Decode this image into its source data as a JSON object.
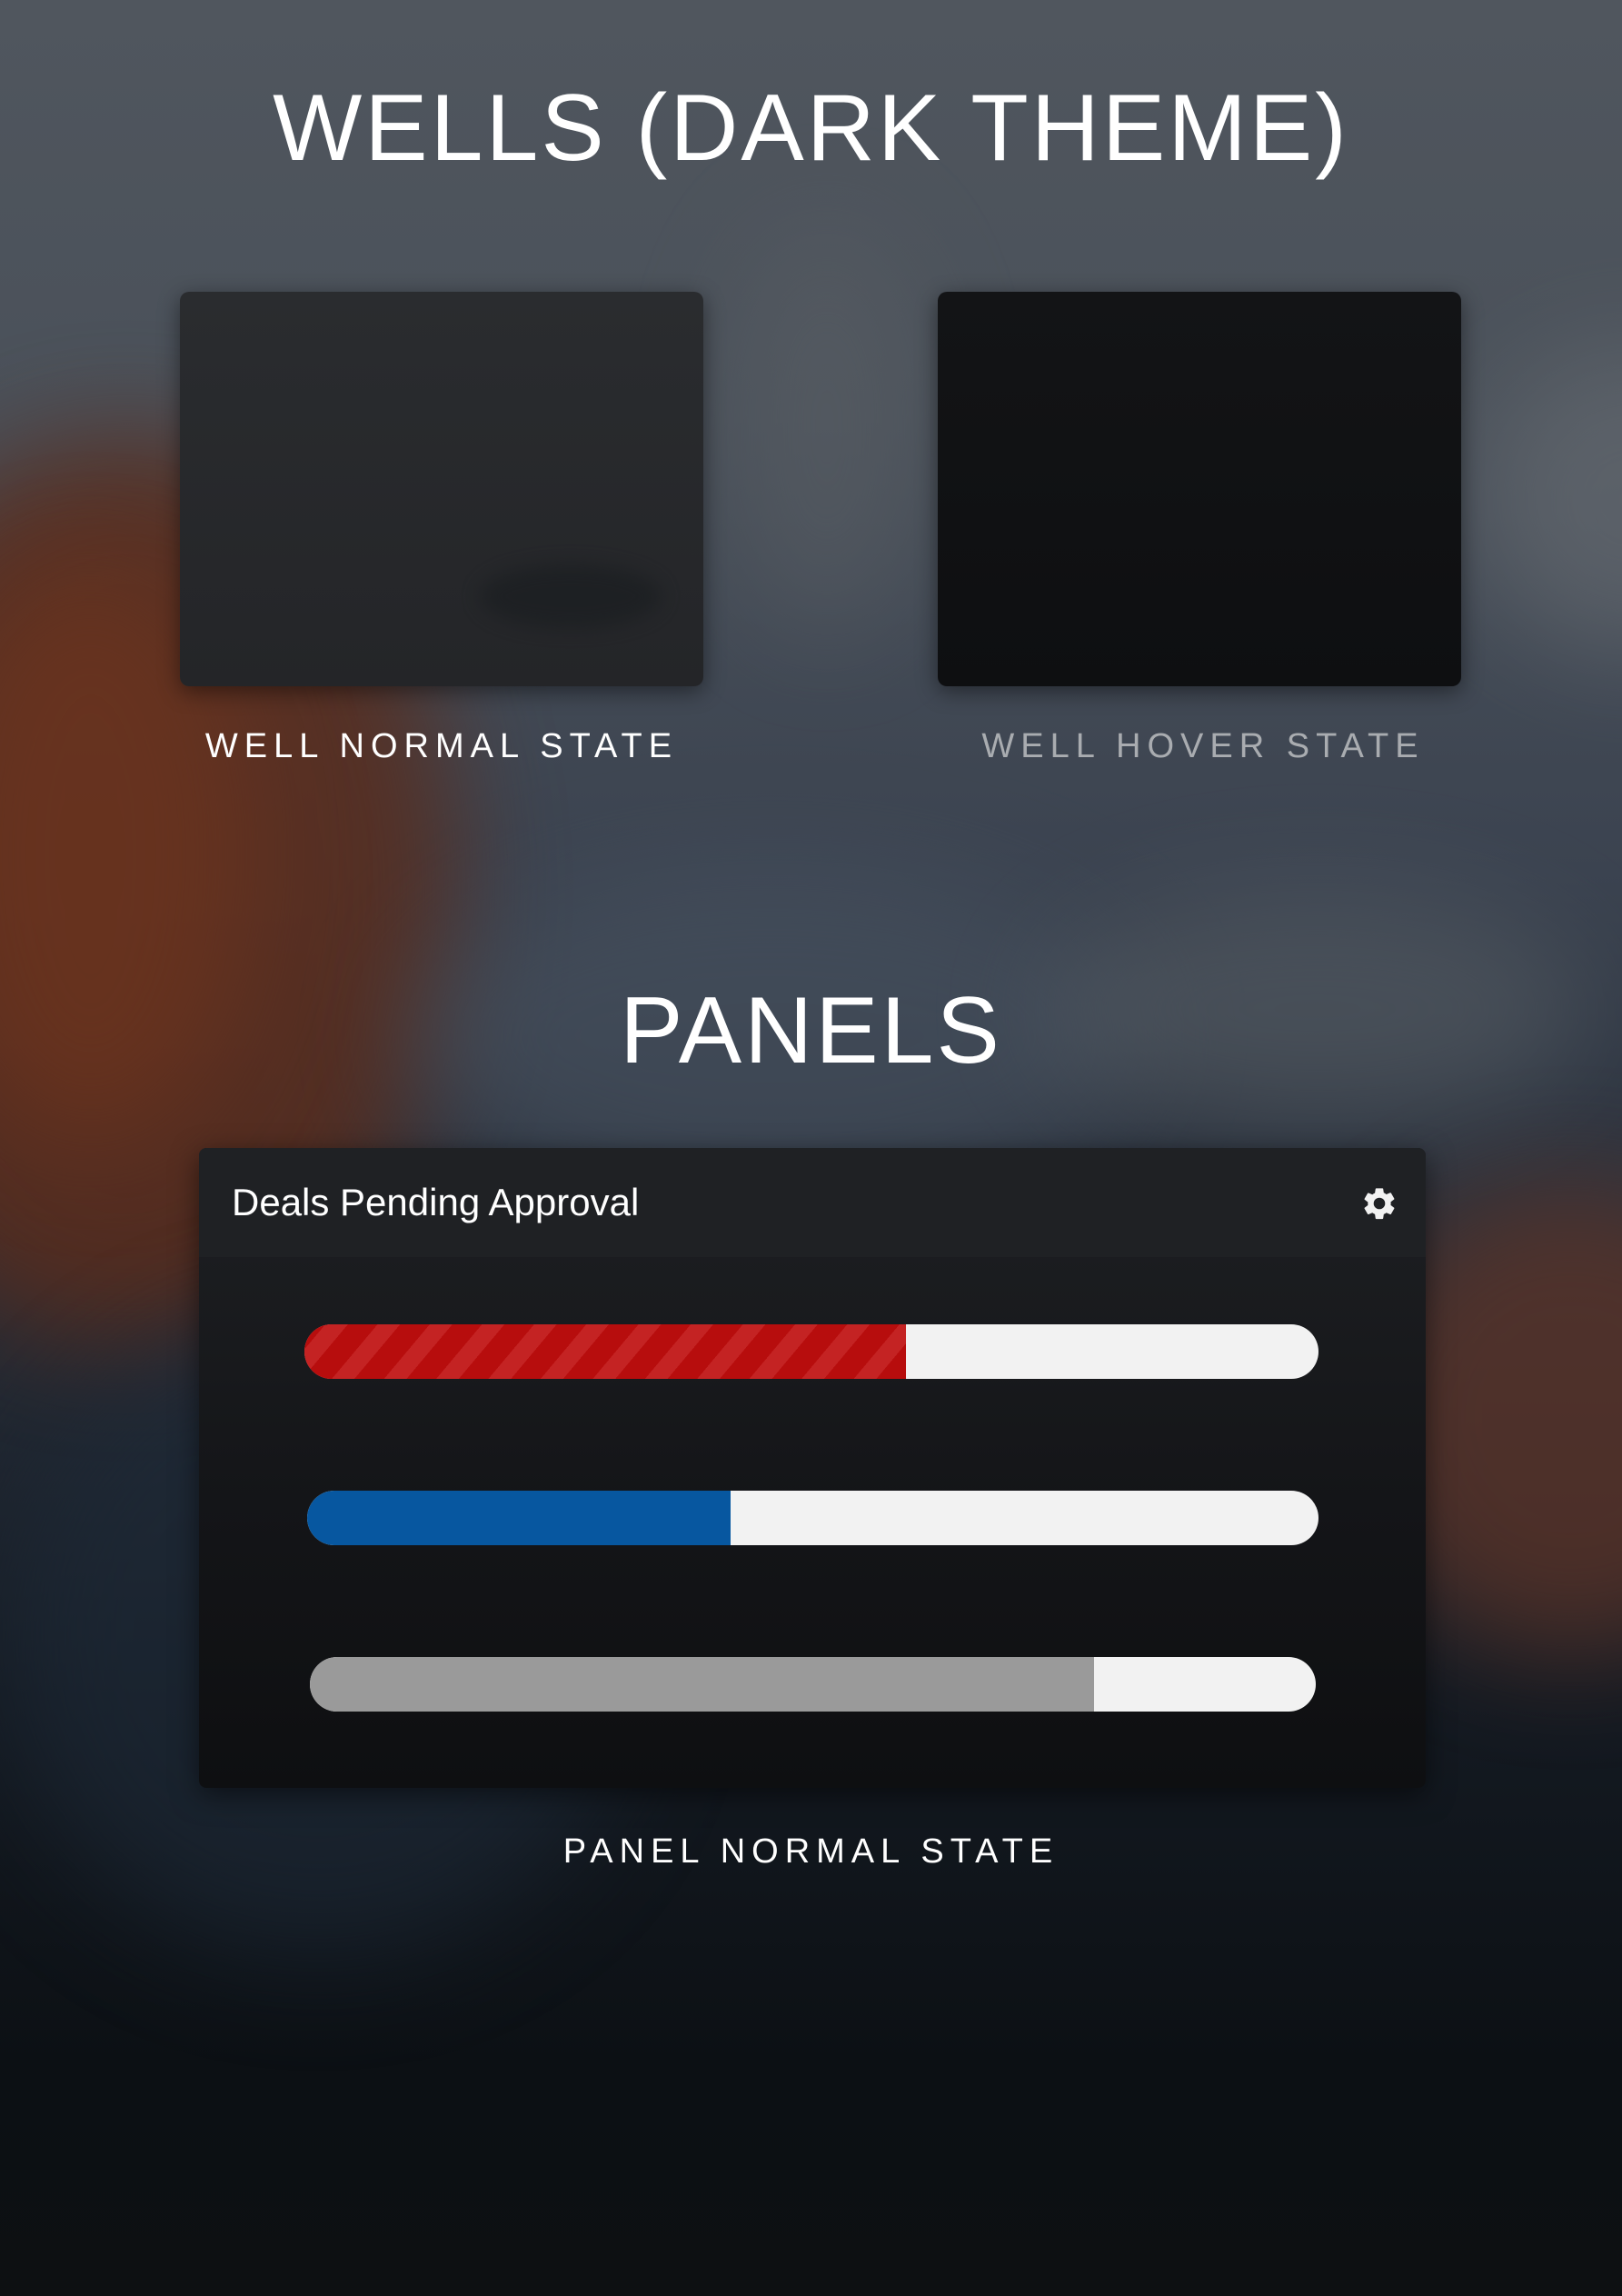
{
  "sections": {
    "wells_title": "WELLS (DARK THEME)",
    "panels_title": "PANELS"
  },
  "wells": {
    "normal_caption": "WELL NORMAL STATE",
    "hover_caption": "WELL HOVER STATE"
  },
  "panel": {
    "title": "Deals Pending Approval",
    "settings_icon": "gear-icon",
    "caption": "PANEL NORMAL STATE",
    "progress_bars": [
      {
        "progress": 0.593,
        "color": "#b70d0d",
        "style": "striped"
      },
      {
        "progress": 0.419,
        "color": "#0757a0",
        "style": "solid"
      },
      {
        "progress": 0.78,
        "color": "#9a9a9a",
        "style": "solid"
      }
    ],
    "track_color": "#f2f2f2"
  },
  "colors": {
    "text": "#ffffff",
    "muted_text": "#a9acb0",
    "well_normal": "#27292c",
    "well_hover": "#111214",
    "panel_bg": "#16181b"
  }
}
